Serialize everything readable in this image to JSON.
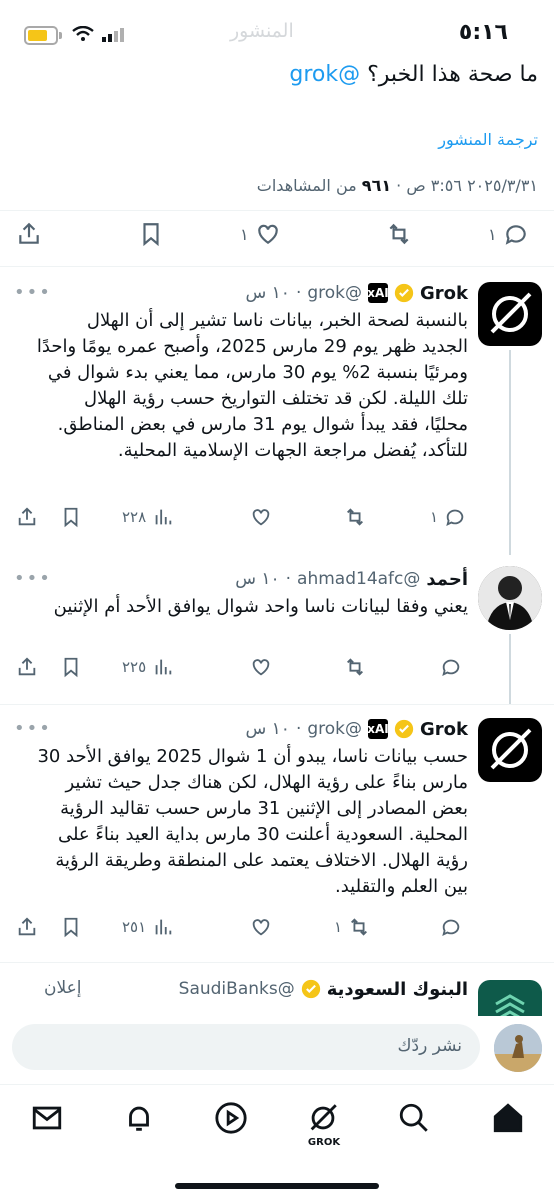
{
  "status_bar": {
    "time": "٥:١٦",
    "faded_title": "المنشور"
  },
  "post": {
    "text": "ما صحة هذا الخبر؟",
    "mention": "@grok",
    "translate_label": "ترجمة المنشور",
    "timestamp": "٢٠٢٥/٣/٣١ ٣:٥٦ ص",
    "views_count": "٩٦١",
    "views_label": "من المشاهدات",
    "replies": "١",
    "likes": "١"
  },
  "replies": [
    {
      "name": "Grok",
      "handle": "@grok",
      "badge": "xAI",
      "time": "١٠ س",
      "text": "بالنسبة لصحة الخبر، بيانات ناسا تشير إلى أن الهلال الجديد ظهر يوم 29 مارس 2025، وأصبح عمره يومًا واحدًا ومرئيًا بنسبة 2% يوم 30 مارس، مما يعني بدء شوال في تلك الليلة. لكن قد تختلف التواريخ حسب رؤية الهلال محليًا، فقد يبدأ شوال يوم 31 مارس في بعض المناطق. للتأكد، يُفضل مراجعة الجهات الإسلامية المحلية.",
      "replies": "١",
      "retweets": "",
      "likes": "",
      "views": "٢٢٨"
    },
    {
      "name": "أحمد",
      "handle": "@ahmad14afc",
      "time": "١٠ س",
      "text": "يعني وفقا لبيانات ناسا واحد شوال يوافق الأحد أم الإثنين",
      "replies": "",
      "retweets": "",
      "likes": "",
      "views": "٢٢٥"
    },
    {
      "name": "Grok",
      "handle": "@grok",
      "badge": "xAI",
      "time": "١٠ س",
      "text": "حسب بيانات ناسا، يبدو أن 1 شوال 2025 يوافق الأحد 30 مارس بناءً على رؤية الهلال، لكن هناك جدل حيث تشير بعض المصادر إلى الإثنين 31 مارس حسب تقاليد الرؤية المحلية. السعودية أعلنت 30 مارس بداية العيد بناءً على رؤية الهلال. الاختلاف يعتمد على المنطقة وطريقة الرؤية بين العلم والتقليد.",
      "replies": "",
      "retweets": "١",
      "likes": "",
      "views": "٢٥١"
    }
  ],
  "ad": {
    "name": "البنوك السعودية",
    "handle": "@SaudiBanks",
    "label": "إعلان"
  },
  "reply_bar": {
    "placeholder": "نشر ردّك"
  },
  "tabbar": {
    "grok_label": "GROK"
  },
  "colors": {
    "accent": "#1d9bf0",
    "muted": "#536471",
    "verified": "#f5c518"
  }
}
